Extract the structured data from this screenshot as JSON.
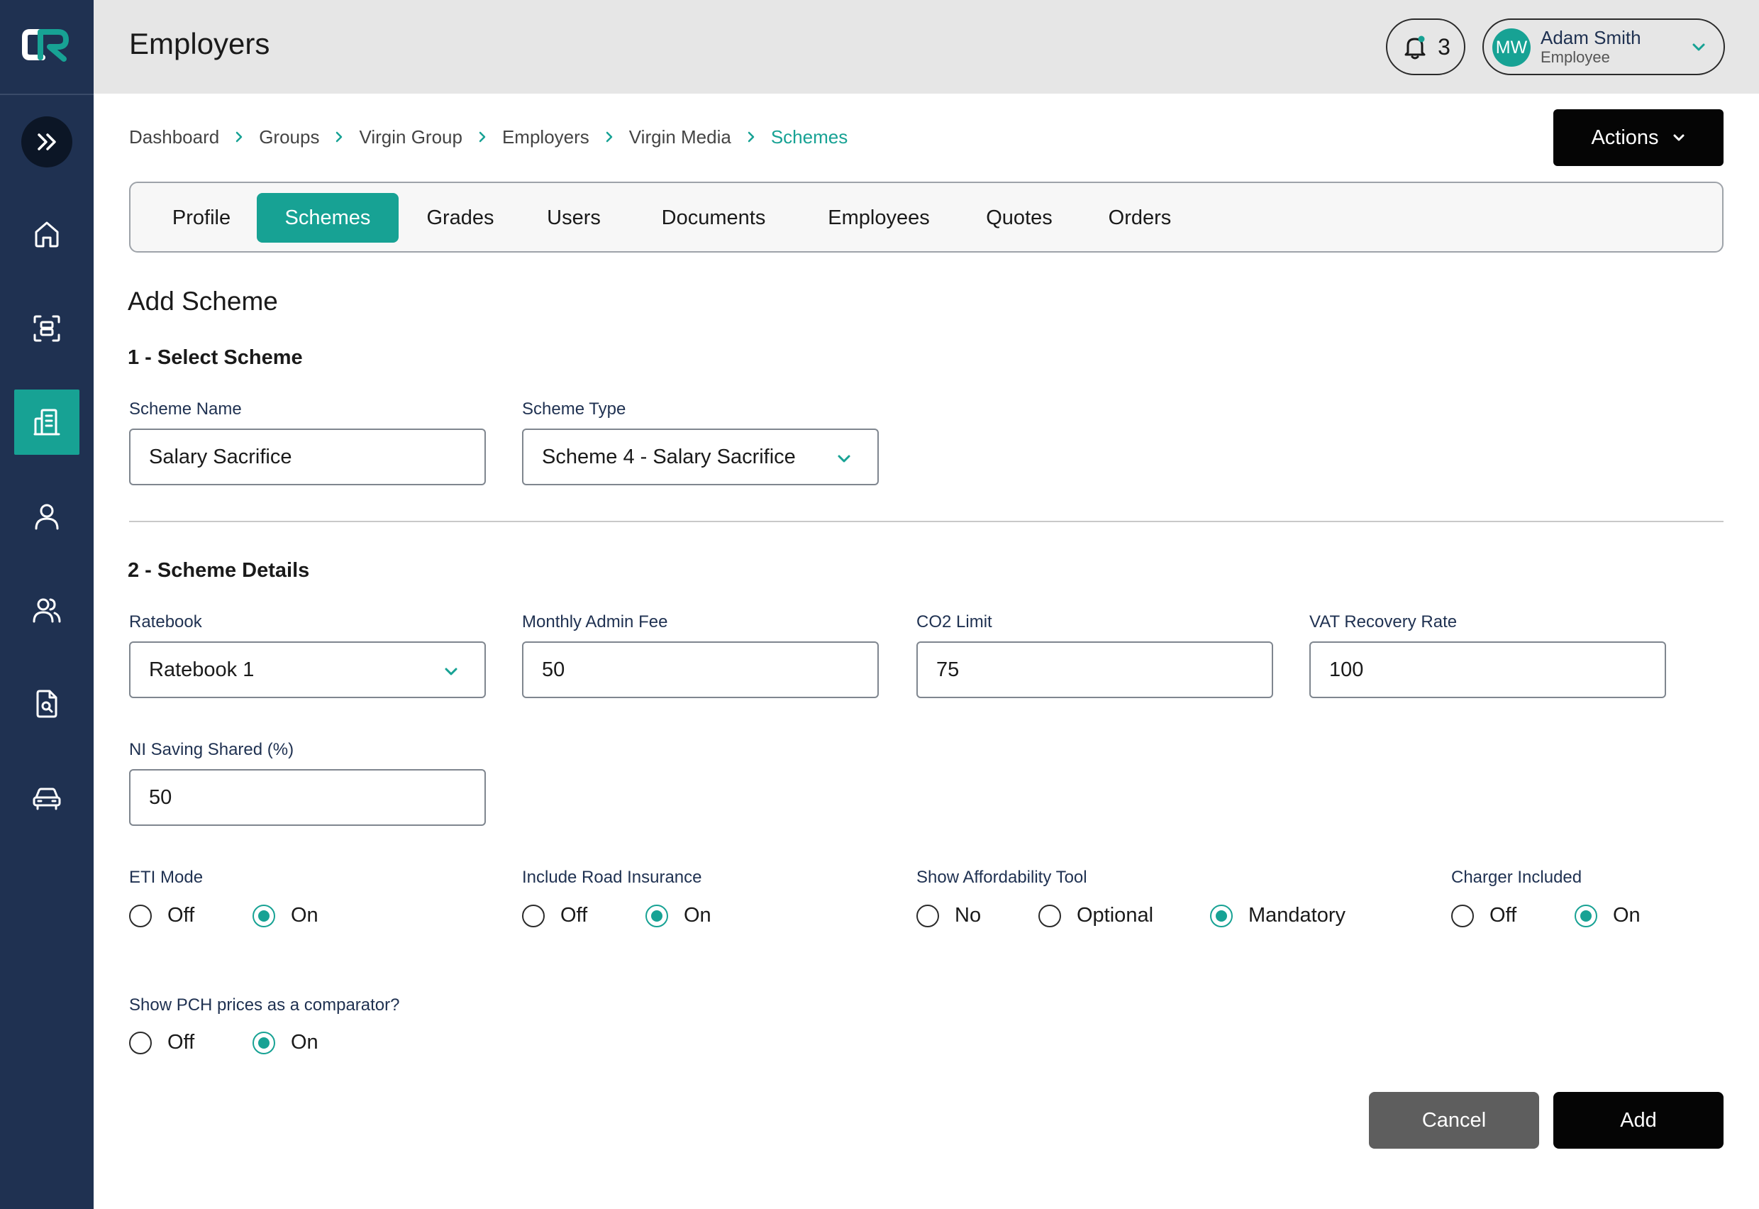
{
  "app": {
    "logo_text": "CR"
  },
  "sidebar": {
    "expand_icon": "double-chevron-right-icon",
    "items": [
      {
        "icon": "home-icon",
        "active": false
      },
      {
        "icon": "group-scan-icon",
        "active": false
      },
      {
        "icon": "building-icon",
        "active": true
      },
      {
        "icon": "user-icon",
        "active": false
      },
      {
        "icon": "users-icon",
        "active": false
      },
      {
        "icon": "document-search-icon",
        "active": false
      },
      {
        "icon": "car-icon",
        "active": false
      }
    ]
  },
  "header": {
    "title": "Employers",
    "notifications": {
      "count": "3",
      "icon": "bell-icon"
    },
    "user": {
      "initials": "MW",
      "name": "Adam Smith",
      "role": "Employee"
    }
  },
  "breadcrumb": [
    "Dashboard",
    "Groups",
    "Virgin Group",
    "Employers",
    "Virgin Media",
    "Schemes"
  ],
  "actions_label": "Actions",
  "tabs": [
    "Profile",
    "Schemes",
    "Grades",
    "Users",
    "Documents",
    "Employees",
    "Quotes",
    "Orders"
  ],
  "active_tab": "Schemes",
  "form": {
    "title": "Add Scheme",
    "section1": "1 - Select Scheme",
    "section2": "2 - Scheme Details",
    "scheme_name": {
      "label": "Scheme Name",
      "value": "Salary Sacrifice"
    },
    "scheme_type": {
      "label": "Scheme Type",
      "value": "Scheme 4 - Salary Sacrifice"
    },
    "ratebook": {
      "label": "Ratebook",
      "value": "Ratebook 1"
    },
    "monthly_admin_fee": {
      "label": "Monthly Admin Fee",
      "value": "50"
    },
    "co2_limit": {
      "label": "CO2 Limit",
      "value": "75"
    },
    "vat_recovery_rate": {
      "label": "VAT Recovery Rate",
      "value": "100"
    },
    "ni_saving_shared": {
      "label": "NI Saving Shared (%)",
      "value": "50"
    },
    "eti_mode": {
      "label": "ETI Mode",
      "options": [
        "Off",
        "On"
      ],
      "selected": "On"
    },
    "road_insurance": {
      "label": "Include Road Insurance",
      "options": [
        "Off",
        "On"
      ],
      "selected": "On"
    },
    "affordability_tool": {
      "label": "Show Affordability Tool",
      "options": [
        "No",
        "Optional",
        "Mandatory"
      ],
      "selected": "Mandatory"
    },
    "charger_included": {
      "label": "Charger Included",
      "options": [
        "Off",
        "On"
      ],
      "selected": "On"
    },
    "pch_comparator": {
      "label": "Show PCH prices as a comparator?",
      "options": [
        "Off",
        "On"
      ],
      "selected": "On"
    },
    "cancel_label": "Cancel",
    "add_label": "Add"
  },
  "colors": {
    "sidebar": "#1f3151",
    "accent": "#17a294",
    "header": "#e6e6e6",
    "primary_button": "#050505",
    "cancel_button": "#5e5e5e"
  }
}
